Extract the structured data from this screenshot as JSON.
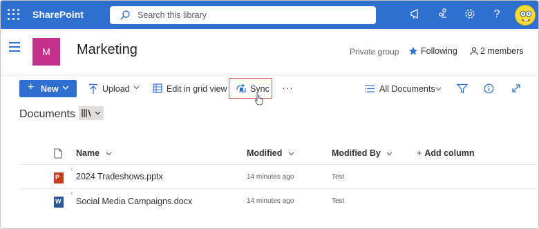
{
  "suite_bar": {
    "app_name": "SharePoint",
    "search_placeholder": "Search this library",
    "icons": [
      "waffle-icon",
      "megaphone-icon",
      "share-icon",
      "gear-icon",
      "help-icon"
    ],
    "accent_color": "#2f6fd0"
  },
  "site": {
    "logo_letter": "M",
    "logo_color": "#c4318b",
    "title": "Marketing",
    "privacy": "Private group",
    "following_label": "Following",
    "members_label": "2 members"
  },
  "command_bar": {
    "new_label": "New",
    "upload_label": "Upload",
    "edit_grid_label": "Edit in grid view",
    "sync_label": "Sync",
    "more_label": "···",
    "view_label": "All Documents"
  },
  "library": {
    "title": "Documents"
  },
  "table": {
    "columns": {
      "name": "Name",
      "modified": "Modified",
      "modified_by": "Modified By",
      "add_column": "Add column"
    },
    "rows": [
      {
        "name": "2024 Tradeshows.pptx",
        "modified": "14 minutes ago",
        "modified_by": "Test",
        "type": "pptx"
      },
      {
        "name": "Social Media Campaigns.docx",
        "modified": "14 minutes ago",
        "modified_by": "Test",
        "type": "docx"
      }
    ]
  }
}
